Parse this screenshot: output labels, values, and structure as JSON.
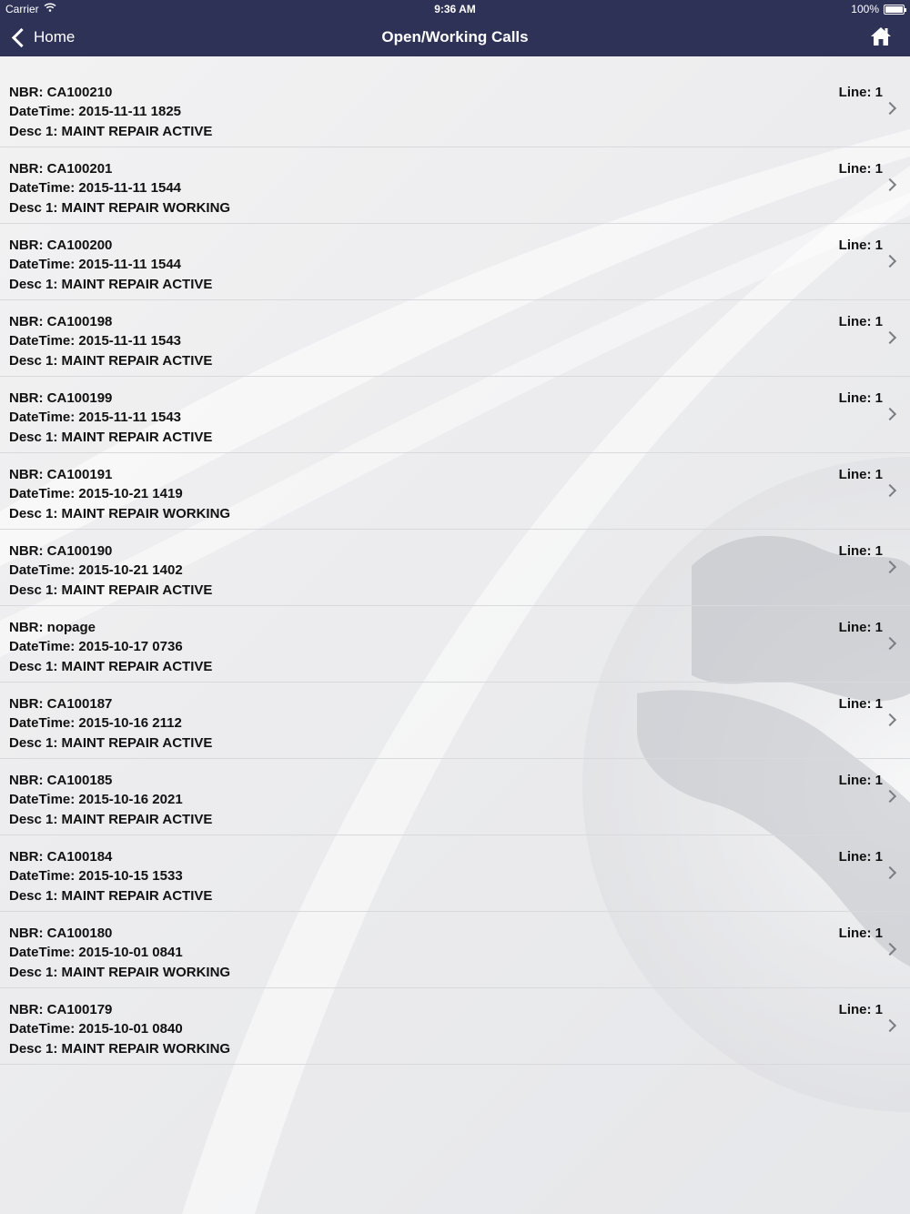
{
  "status_bar": {
    "carrier": "Carrier",
    "time": "9:36 AM",
    "battery": "100%"
  },
  "nav": {
    "back_label": "Home",
    "title": "Open/Working Calls"
  },
  "colors": {
    "nav_background": "#2e3257",
    "separator": "#d8d9dd",
    "chevron": "#7b7d83"
  },
  "calls": [
    {
      "nbr": "NBR: CA100210",
      "datetime": "DateTime: 2015-11-11 1825",
      "desc": "Desc 1: MAINT REPAIR ACTIVE",
      "line": "Line: 1"
    },
    {
      "nbr": "NBR: CA100201",
      "datetime": "DateTime: 2015-11-11 1544",
      "desc": "Desc 1: MAINT REPAIR WORKING",
      "line": "Line: 1"
    },
    {
      "nbr": "NBR: CA100200",
      "datetime": "DateTime: 2015-11-11 1544",
      "desc": "Desc 1: MAINT REPAIR ACTIVE",
      "line": "Line: 1"
    },
    {
      "nbr": "NBR: CA100198",
      "datetime": "DateTime: 2015-11-11 1543",
      "desc": "Desc 1: MAINT REPAIR ACTIVE",
      "line": "Line: 1"
    },
    {
      "nbr": "NBR: CA100199",
      "datetime": "DateTime: 2015-11-11 1543",
      "desc": "Desc 1: MAINT REPAIR ACTIVE",
      "line": "Line: 1"
    },
    {
      "nbr": "NBR: CA100191",
      "datetime": "DateTime: 2015-10-21 1419",
      "desc": "Desc 1: MAINT REPAIR WORKING",
      "line": "Line: 1"
    },
    {
      "nbr": "NBR: CA100190",
      "datetime": "DateTime: 2015-10-21 1402",
      "desc": "Desc 1: MAINT REPAIR ACTIVE",
      "line": "Line: 1"
    },
    {
      "nbr": "NBR: nopage",
      "datetime": "DateTime: 2015-10-17 0736",
      "desc": "Desc 1: MAINT REPAIR ACTIVE",
      "line": "Line: 1"
    },
    {
      "nbr": "NBR: CA100187",
      "datetime": "DateTime: 2015-10-16 2112",
      "desc": "Desc 1: MAINT REPAIR ACTIVE",
      "line": "Line: 1"
    },
    {
      "nbr": "NBR: CA100185",
      "datetime": "DateTime: 2015-10-16 2021",
      "desc": "Desc 1: MAINT REPAIR ACTIVE",
      "line": "Line: 1"
    },
    {
      "nbr": "NBR: CA100184",
      "datetime": "DateTime: 2015-10-15 1533",
      "desc": "Desc 1: MAINT REPAIR ACTIVE",
      "line": "Line: 1"
    },
    {
      "nbr": "NBR: CA100180",
      "datetime": "DateTime: 2015-10-01 0841",
      "desc": "Desc 1: MAINT REPAIR WORKING",
      "line": "Line: 1"
    },
    {
      "nbr": "NBR: CA100179",
      "datetime": "DateTime: 2015-10-01 0840",
      "desc": "Desc 1: MAINT REPAIR WORKING",
      "line": "Line: 1"
    }
  ]
}
